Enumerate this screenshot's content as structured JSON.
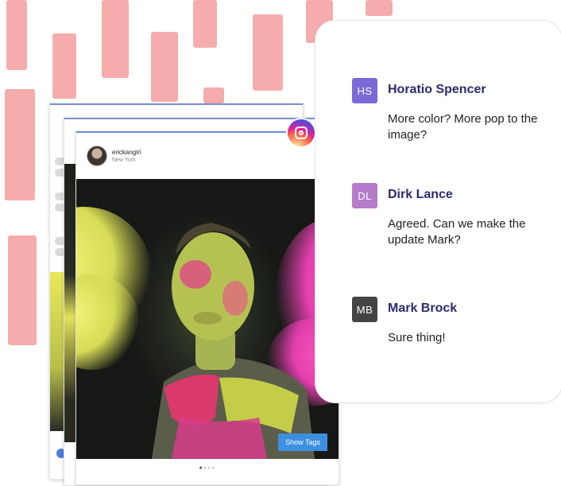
{
  "colors": {
    "brush": "#f5a3a3",
    "name": "#2b2b6b",
    "show_tags_button": "#3d8fe0",
    "badge_hs": "#7b6ad6",
    "badge_dl": "#b47cc9",
    "badge_mb": "#444444"
  },
  "post": {
    "username": "erickangiri",
    "location": "New York",
    "show_tags_label": "Show Tags",
    "carousel_dots": [
      "●",
      "●",
      "●",
      "●"
    ],
    "icon": "instagram-icon"
  },
  "comments": [
    {
      "initials": "HS",
      "name": "Horatio Spencer",
      "text": "More color? More pop to the image?"
    },
    {
      "initials": "DL",
      "name": "Dirk Lance",
      "text": "Agreed. Can we make the update Mark?"
    },
    {
      "initials": "MB",
      "name": "Mark Brock",
      "text": "Sure thing!"
    }
  ]
}
